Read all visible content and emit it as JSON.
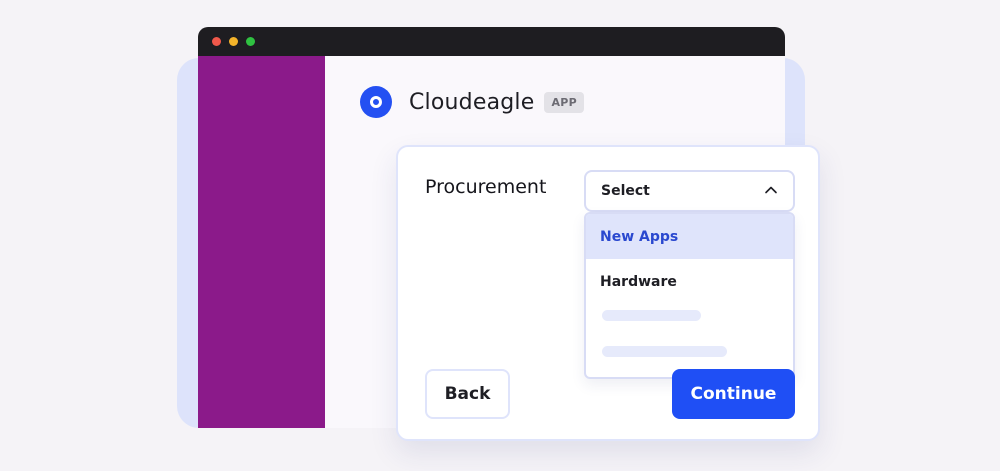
{
  "app": {
    "name": "Cloudeagle",
    "badge": "APP",
    "logo_icon": "cloudeagle-logo-icon"
  },
  "colors": {
    "sidebar": "#8b1a8a",
    "accent": "#1f4ff5",
    "titlebar": "#1e1d21",
    "backdrop": "#dde3fb",
    "highlight": "#dfe4fb"
  },
  "window_controls": [
    "close",
    "minimize",
    "maximize"
  ],
  "form": {
    "field_label": "Procurement",
    "select": {
      "value": "Select",
      "icon": "chevron-up-icon",
      "expanded": true
    },
    "options": [
      {
        "label": "New Apps",
        "highlighted": true
      },
      {
        "label": "Hardware",
        "highlighted": false
      }
    ],
    "placeholder_option_count": 2
  },
  "buttons": {
    "back": "Back",
    "continue": "Continue"
  }
}
